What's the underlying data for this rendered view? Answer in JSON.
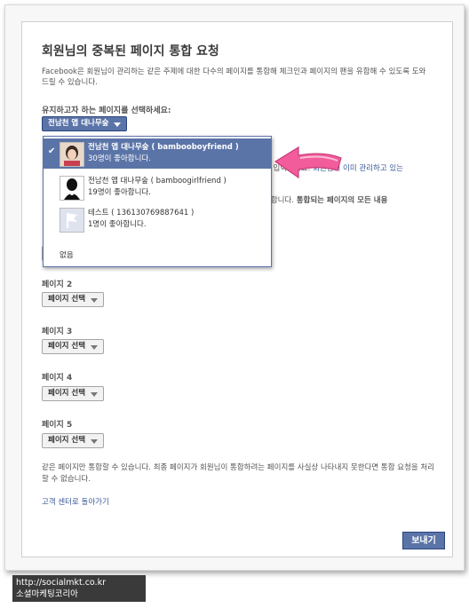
{
  "dialog": {
    "title": "회원님의 중복된 페이지 통합 요청",
    "description": "Facebook은 회원님이 관리하는 같은 주제에 대한 다수의 페이지를 통합해 체크인과 페이지의 팬을 유합해 수 있도록 도와드릴 수 있습니다.",
    "keep_label": "유지하고자 하는 페이지를 선택하세요:",
    "keep_select": "전남천 앱 대나무숲",
    "covered_text_1a": "을 입력하세요.",
    "covered_text_1b": "회원님이 이미 관리하고 있는",
    "covered_text_2a": "통합니다.",
    "covered_text_2b": "통합되는 페이지의 모든 내용",
    "page_select_label": "페이지 선택",
    "page_labels": [
      "페이지 2",
      "페이지 3",
      "페이지 4",
      "페이지 5"
    ],
    "note": "같은 페이지만 통합할 수 있습니다. 최종 페이지가 회원님이 통합하려는 페이지를 사실상 나타내지 못한다면 통합 요청을 처리할 수 없습니다.",
    "back_link": "고객 센터로 돌아가기",
    "send_button": "보내기"
  },
  "dropdown": {
    "items": [
      {
        "name": "전남천 앱 대나무숲 ( bambooboyfriend )",
        "likes": "30명이 좋아합니다.",
        "selected": true,
        "icon": "profile-photo"
      },
      {
        "name": "전남천 앱 대나무숲 ( bamboogirlfriend )",
        "likes": "19명이 좋아합니다.",
        "selected": false,
        "icon": "silhouette-photo"
      },
      {
        "name": "테스트 ( 136130769887641 )",
        "likes": "1명이 좋아합니다.",
        "selected": false,
        "icon": "default-flag-photo"
      }
    ],
    "none_option": "없음"
  },
  "caption": {
    "url": "http://socialmkt.co.kr",
    "name": "소셜마케팅코리아"
  },
  "colors": {
    "accent": "#5b74a8",
    "link": "#3b5998",
    "arrow": "#f25c9b"
  }
}
